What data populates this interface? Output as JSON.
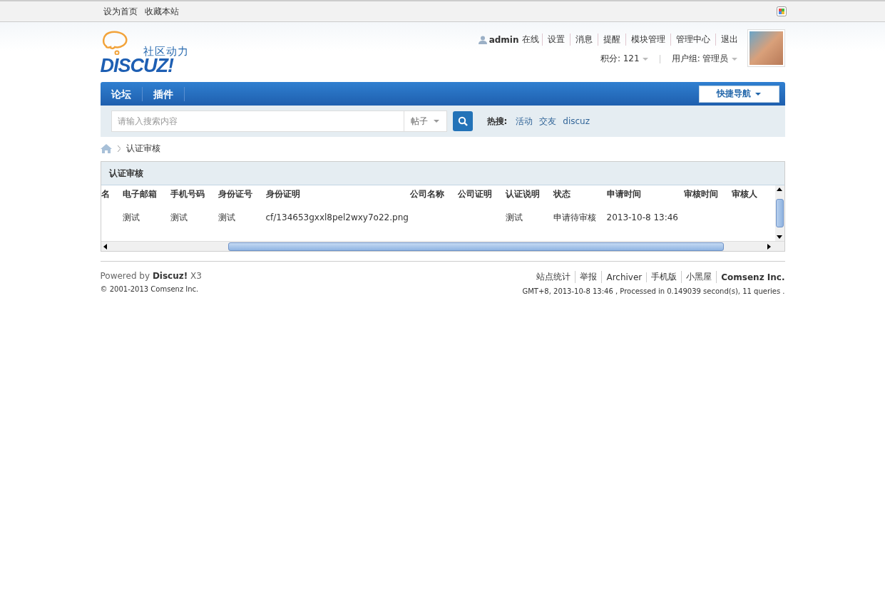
{
  "top_bar": {
    "links": [
      "设为首页",
      "收藏本站"
    ]
  },
  "logo": {
    "tagline": "社区动力",
    "wordmark": "DISCUZ!"
  },
  "user": {
    "name": "admin",
    "status": "在线",
    "links": [
      "设置",
      "消息",
      "提醒",
      "模块管理",
      "管理中心",
      "退出"
    ],
    "credits": "积分: 121",
    "group": "用户组: 管理员"
  },
  "nav": {
    "items": [
      "论坛",
      "插件"
    ],
    "quick_nav": "快捷导航"
  },
  "search": {
    "placeholder": "请输入搜索内容",
    "type": "帖子",
    "hot_label": "热搜:",
    "hot": [
      "活动",
      "交友",
      "discuz"
    ]
  },
  "breadcrumb": [
    "认证审核"
  ],
  "panel": {
    "title": "认证审核",
    "columns": [
      "名",
      "电子邮箱",
      "手机号码",
      "身份证号",
      "身份证明",
      "公司名称",
      "公司证明",
      "认证说明",
      "状态",
      "申请时间",
      "审核时间",
      "审核人"
    ],
    "rows": [
      [
        "",
        "测试",
        "测试",
        "测试",
        "cf/134653gxxl8pel2wxy7o22.png",
        "",
        "",
        "测试",
        "申请待审核",
        "2013-10-8 13:46",
        "",
        ""
      ]
    ]
  },
  "footer": {
    "powered": "Powered by **Discuz!** X3",
    "copyright": "© 2001-2013 Comsenz Inc.",
    "links": [
      "站点统计",
      "举报",
      "Archiver",
      "手机版",
      "小黑屋"
    ],
    "company": "Comsenz Inc.",
    "stats": "GMT+8, 2013-10-8 13:46 , Processed in 0.149039 second(s), 11 queries ."
  }
}
